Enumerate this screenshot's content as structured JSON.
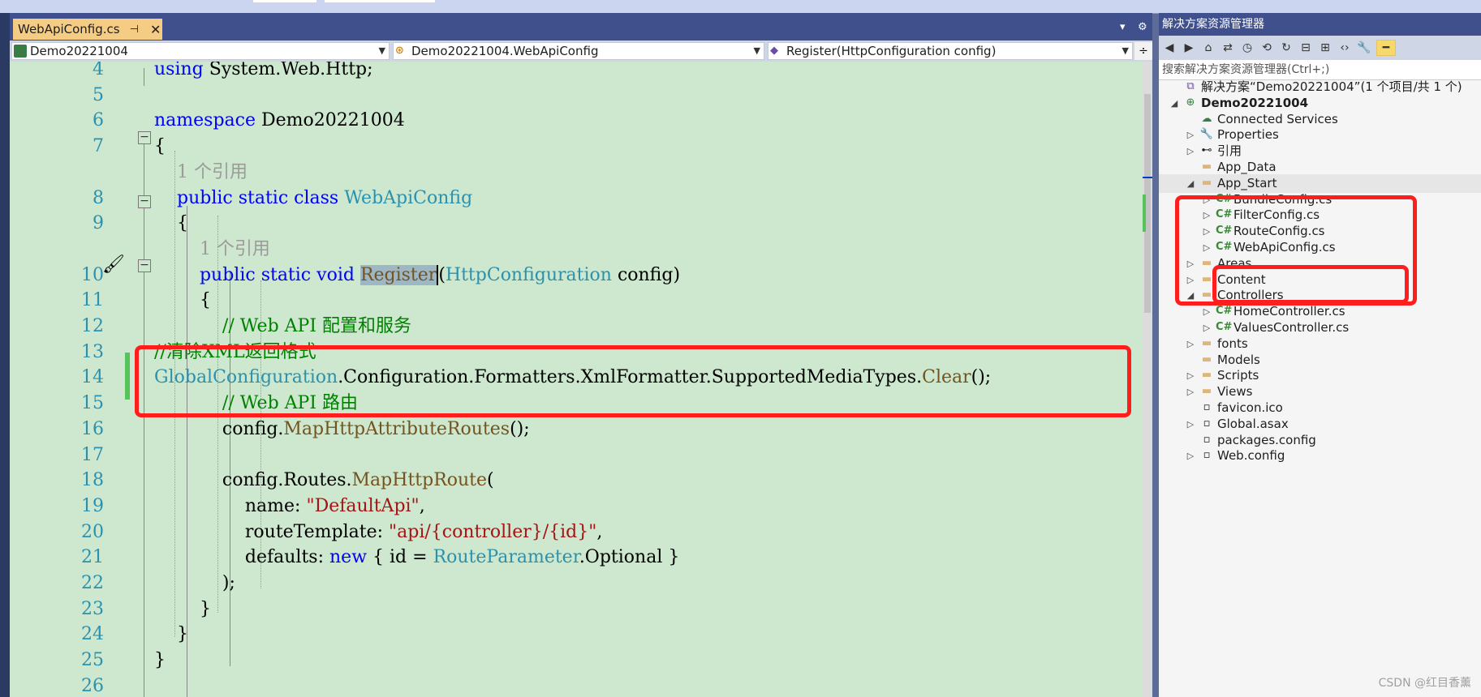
{
  "tab": {
    "title": "WebApiConfig.cs",
    "pin": "⊣",
    "close": "✕"
  },
  "nav": {
    "project": "Demo20221004",
    "class": "Demo20221004.WebApiConfig",
    "member": "Register(HttpConfiguration config)"
  },
  "code": {
    "lines": [
      {
        "n": "4",
        "segments": [
          {
            "t": "using",
            "c": "kw"
          },
          {
            "t": " System.Web.Http;",
            "c": ""
          }
        ]
      },
      {
        "n": "5",
        "segments": []
      },
      {
        "n": "6",
        "segments": [
          {
            "t": "namespace",
            "c": "kw"
          },
          {
            "t": " Demo20221004",
            "c": ""
          }
        ]
      },
      {
        "n": "7",
        "segments": [
          {
            "t": "{",
            "c": ""
          }
        ]
      },
      {
        "n": "",
        "segments": [
          {
            "t": "    1 个引用",
            "c": "hint"
          }
        ]
      },
      {
        "n": "8",
        "segments": [
          {
            "t": "    ",
            "c": ""
          },
          {
            "t": "public",
            "c": "kw"
          },
          {
            "t": " ",
            "c": ""
          },
          {
            "t": "static",
            "c": "kw"
          },
          {
            "t": " ",
            "c": ""
          },
          {
            "t": "class",
            "c": "kw"
          },
          {
            "t": " ",
            "c": ""
          },
          {
            "t": "WebApiConfig",
            "c": "ty"
          }
        ]
      },
      {
        "n": "9",
        "segments": [
          {
            "t": "    {",
            "c": ""
          }
        ]
      },
      {
        "n": "",
        "segments": [
          {
            "t": "        1 个引用",
            "c": "hint"
          }
        ]
      },
      {
        "n": "10",
        "segments": [
          {
            "t": "        ",
            "c": ""
          },
          {
            "t": "public",
            "c": "kw"
          },
          {
            "t": " ",
            "c": ""
          },
          {
            "t": "static",
            "c": "kw"
          },
          {
            "t": " ",
            "c": ""
          },
          {
            "t": "void",
            "c": "kw"
          },
          {
            "t": " ",
            "c": ""
          },
          {
            "t": "Register",
            "c": "mt hl"
          },
          {
            "t": "(",
            "c": ""
          },
          {
            "t": "HttpConfiguration",
            "c": "ty"
          },
          {
            "t": " config)",
            "c": ""
          }
        ]
      },
      {
        "n": "11",
        "segments": [
          {
            "t": "        {",
            "c": ""
          }
        ]
      },
      {
        "n": "12",
        "segments": [
          {
            "t": "            // Web API 配置和服务",
            "c": "cm"
          }
        ]
      },
      {
        "n": "13",
        "segments": [
          {
            "t": "//清除XML返回格式",
            "c": "cm"
          }
        ]
      },
      {
        "n": "14",
        "segments": [
          {
            "t": "GlobalConfiguration",
            "c": "ty"
          },
          {
            "t": ".Configuration.Formatters.XmlFormatter.SupportedMediaTypes.",
            "c": ""
          },
          {
            "t": "Clear",
            "c": "mt"
          },
          {
            "t": "();",
            "c": ""
          }
        ]
      },
      {
        "n": "15",
        "segments": [
          {
            "t": "            // Web API 路由",
            "c": "cm"
          }
        ]
      },
      {
        "n": "16",
        "segments": [
          {
            "t": "            config.",
            "c": ""
          },
          {
            "t": "MapHttpAttributeRoutes",
            "c": "mt"
          },
          {
            "t": "();",
            "c": ""
          }
        ]
      },
      {
        "n": "17",
        "segments": []
      },
      {
        "n": "18",
        "segments": [
          {
            "t": "            config.Routes.",
            "c": ""
          },
          {
            "t": "MapHttpRoute",
            "c": "mt"
          },
          {
            "t": "(",
            "c": ""
          }
        ]
      },
      {
        "n": "19",
        "segments": [
          {
            "t": "                name: ",
            "c": ""
          },
          {
            "t": "\"DefaultApi\"",
            "c": "str"
          },
          {
            "t": ",",
            "c": ""
          }
        ]
      },
      {
        "n": "20",
        "segments": [
          {
            "t": "                routeTemplate: ",
            "c": ""
          },
          {
            "t": "\"api/{controller}/{id}\"",
            "c": "str"
          },
          {
            "t": ",",
            "c": ""
          }
        ]
      },
      {
        "n": "21",
        "segments": [
          {
            "t": "                defaults: ",
            "c": ""
          },
          {
            "t": "new",
            "c": "kw"
          },
          {
            "t": " { id = ",
            "c": ""
          },
          {
            "t": "RouteParameter",
            "c": "ty"
          },
          {
            "t": ".Optional }",
            "c": ""
          }
        ]
      },
      {
        "n": "22",
        "segments": [
          {
            "t": "            );",
            "c": ""
          }
        ]
      },
      {
        "n": "23",
        "segments": [
          {
            "t": "        }",
            "c": ""
          }
        ]
      },
      {
        "n": "24",
        "segments": [
          {
            "t": "    }",
            "c": ""
          }
        ]
      },
      {
        "n": "25",
        "segments": [
          {
            "t": "}",
            "c": ""
          }
        ]
      },
      {
        "n": "26",
        "segments": []
      }
    ]
  },
  "solution_explorer": {
    "title": "解决方案资源管理器",
    "title_buttons": [
      "▾",
      "⊹",
      "✕"
    ],
    "search_placeholder": "搜索解决方案资源管理器(Ctrl+;)",
    "nodes": [
      {
        "label": "解决方案“Demo20221004”(1 个项目/共 1 个)",
        "depth": 0,
        "exp": "",
        "icon": "solution-icon",
        "glyph": "⧉",
        "bold": false
      },
      {
        "label": "Demo20221004",
        "depth": 0,
        "exp": "◢",
        "icon": "project-icon",
        "glyph": "⊕",
        "bold": true
      },
      {
        "label": "Connected Services",
        "depth": 1,
        "exp": "",
        "icon": "connected-services-icon",
        "glyph": "☁",
        "bold": false
      },
      {
        "label": "Properties",
        "depth": 1,
        "exp": "▷",
        "icon": "wrench-icon",
        "glyph": "🔧",
        "bold": false
      },
      {
        "label": "引用",
        "depth": 1,
        "exp": "▷",
        "icon": "references-icon",
        "glyph": "⊷",
        "bold": false
      },
      {
        "label": "App_Data",
        "depth": 1,
        "exp": "",
        "icon": "folder-icon",
        "glyph": "▬",
        "bold": false
      },
      {
        "label": "App_Start",
        "depth": 1,
        "exp": "◢",
        "icon": "folder-open-icon",
        "glyph": "▬",
        "bold": false,
        "sel": true
      },
      {
        "label": "BundleConfig.cs",
        "depth": 2,
        "exp": "▷",
        "icon": "csharp-file-icon",
        "glyph": "C#",
        "bold": false
      },
      {
        "label": "FilterConfig.cs",
        "depth": 2,
        "exp": "▷",
        "icon": "csharp-file-icon",
        "glyph": "C#",
        "bold": false
      },
      {
        "label": "RouteConfig.cs",
        "depth": 2,
        "exp": "▷",
        "icon": "csharp-file-icon",
        "glyph": "C#",
        "bold": false
      },
      {
        "label": "WebApiConfig.cs",
        "depth": 2,
        "exp": "▷",
        "icon": "csharp-file-icon",
        "glyph": "C#",
        "bold": false
      },
      {
        "label": "Areas",
        "depth": 1,
        "exp": "▷",
        "icon": "folder-icon",
        "glyph": "▬",
        "bold": false
      },
      {
        "label": "Content",
        "depth": 1,
        "exp": "▷",
        "icon": "folder-icon",
        "glyph": "▬",
        "bold": false
      },
      {
        "label": "Controllers",
        "depth": 1,
        "exp": "◢",
        "icon": "folder-open-icon",
        "glyph": "▬",
        "bold": false
      },
      {
        "label": "HomeController.cs",
        "depth": 2,
        "exp": "▷",
        "icon": "csharp-file-icon",
        "glyph": "C#",
        "bold": false
      },
      {
        "label": "ValuesController.cs",
        "depth": 2,
        "exp": "▷",
        "icon": "csharp-file-icon",
        "glyph": "C#",
        "bold": false
      },
      {
        "label": "fonts",
        "depth": 1,
        "exp": "▷",
        "icon": "folder-icon",
        "glyph": "▬",
        "bold": false
      },
      {
        "label": "Models",
        "depth": 1,
        "exp": "",
        "icon": "folder-icon",
        "glyph": "▬",
        "bold": false
      },
      {
        "label": "Scripts",
        "depth": 1,
        "exp": "▷",
        "icon": "folder-icon",
        "glyph": "▬",
        "bold": false
      },
      {
        "label": "Views",
        "depth": 1,
        "exp": "▷",
        "icon": "folder-icon",
        "glyph": "▬",
        "bold": false
      },
      {
        "label": "favicon.ico",
        "depth": 1,
        "exp": "",
        "icon": "file-icon",
        "glyph": "▫",
        "bold": false
      },
      {
        "label": "Global.asax",
        "depth": 1,
        "exp": "▷",
        "icon": "file-icon",
        "glyph": "▫",
        "bold": false
      },
      {
        "label": "packages.config",
        "depth": 1,
        "exp": "",
        "icon": "config-file-icon",
        "glyph": "▫",
        "bold": false
      },
      {
        "label": "Web.config",
        "depth": 1,
        "exp": "▷",
        "icon": "config-file-icon",
        "glyph": "▫",
        "bold": false
      }
    ]
  },
  "watermark": "CSDN @红目香薰",
  "colors": {
    "annotation": "#ff1e1e",
    "editor_bg": "#cde8ce",
    "tab_active": "#f5cc84"
  }
}
